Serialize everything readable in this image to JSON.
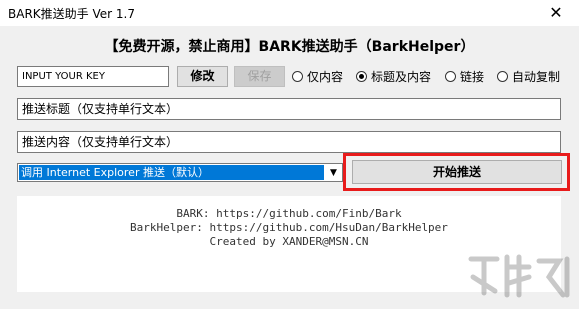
{
  "window": {
    "title": "BARK推送助手 Ver 1.7",
    "close_symbol": "✕"
  },
  "heading": "【免费开源，禁止商用】BARK推送助手（BarkHelper）",
  "key_input": {
    "value": "INPUT YOUR KEY"
  },
  "buttons": {
    "edit": "修改",
    "save": "保存",
    "send": "开始推送"
  },
  "radios": [
    {
      "label": "仅内容",
      "checked": false
    },
    {
      "label": "标题及内容",
      "checked": true
    },
    {
      "label": "链接",
      "checked": false
    },
    {
      "label": "自动复制",
      "checked": false
    }
  ],
  "title_input": {
    "value": "推送标题（仅支持单行文本）"
  },
  "content_input": {
    "value": "推送内容（仅支持单行文本）"
  },
  "method_select": {
    "selected": "调用 Internet Explorer 推送（默认）"
  },
  "info": {
    "line1": "BARK: https://github.com/Finb/Bark",
    "line2": "BarkHelper: https://github.com/HsuDan/BarkHelper",
    "line3": "Created by XANDER@MSN.CN"
  },
  "colors": {
    "highlight": "#e81b1b",
    "selection": "#0078d7"
  }
}
